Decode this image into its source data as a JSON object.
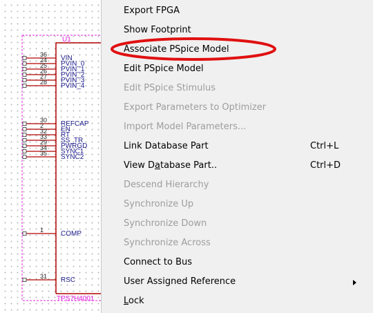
{
  "schematic": {
    "refdes": "U1",
    "part_value": "TPS7H4001",
    "pins": [
      {
        "num": "36",
        "name": "VIN"
      },
      {
        "num": "24",
        "name": "PVIN_0"
      },
      {
        "num": "25",
        "name": "PVIN_1"
      },
      {
        "num": "26",
        "name": "PVIN_2"
      },
      {
        "num": "27",
        "name": "PVIN_3"
      },
      {
        "num": "28",
        "name": "PVIN_4"
      },
      {
        "num": "30",
        "name": "REFCAP"
      },
      {
        "num": "2",
        "name": "EN"
      },
      {
        "num": "32",
        "name": "RT"
      },
      {
        "num": "33",
        "name": "SS_TR"
      },
      {
        "num": "29",
        "name": "PWRGD"
      },
      {
        "num": "34",
        "name": "SYNC1"
      },
      {
        "num": "35",
        "name": "SYNC2"
      },
      {
        "num": "1",
        "name": "COMP"
      },
      {
        "num": "31",
        "name": "RSC"
      }
    ],
    "colors": {
      "part_outline": "#e020e0",
      "body_line": "#b00000",
      "pin_text": "#1a1a8c",
      "highlight_ellipse": "#e01010"
    }
  },
  "context_menu": {
    "items": [
      {
        "label": "Export FPGA",
        "enabled": true,
        "shortcut": "",
        "submenu": false
      },
      {
        "label": "Show Footprint",
        "enabled": true,
        "shortcut": "",
        "submenu": false
      },
      {
        "label": "Associate PSpice Model",
        "enabled": true,
        "shortcut": "",
        "submenu": false,
        "circled": true
      },
      {
        "label": "Edit PSpice Model",
        "enabled": true,
        "shortcut": "",
        "submenu": false
      },
      {
        "label": "Edit PSpice Stimulus",
        "enabled": false,
        "shortcut": "",
        "submenu": false
      },
      {
        "label": "Export Parameters to Optimizer",
        "enabled": false,
        "shortcut": "",
        "submenu": false
      },
      {
        "label": "Import Model Parameters...",
        "enabled": false,
        "shortcut": "",
        "submenu": false
      },
      {
        "label": "Link Database Part",
        "enabled": true,
        "shortcut": "Ctrl+L",
        "submenu": false
      },
      {
        "label": "View Database Part..",
        "enabled": true,
        "shortcut": "Ctrl+D",
        "submenu": false,
        "mnemonic_index": 6
      },
      {
        "label": "Descend Hierarchy",
        "enabled": false,
        "shortcut": "",
        "submenu": false
      },
      {
        "label": "Synchronize Up",
        "enabled": false,
        "shortcut": "",
        "submenu": false
      },
      {
        "label": "Synchronize Down",
        "enabled": false,
        "shortcut": "",
        "submenu": false
      },
      {
        "label": "Synchronize Across",
        "enabled": false,
        "shortcut": "",
        "submenu": false
      },
      {
        "label": "Connect to Bus",
        "enabled": true,
        "shortcut": "",
        "submenu": false
      },
      {
        "label": "User Assigned Reference",
        "enabled": true,
        "shortcut": "",
        "submenu": true
      },
      {
        "label": "Lock",
        "enabled": true,
        "shortcut": "",
        "submenu": false,
        "mnemonic_index": 0
      }
    ]
  }
}
